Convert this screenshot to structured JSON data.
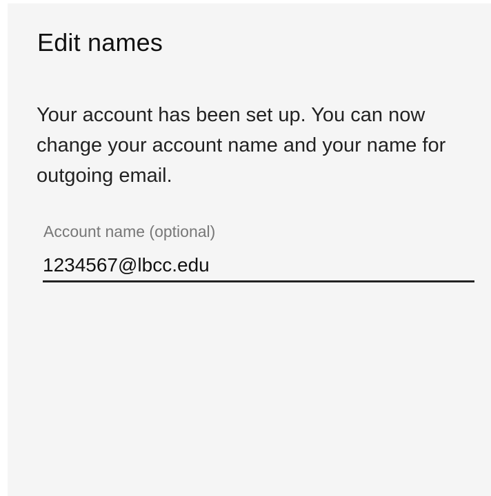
{
  "dialog": {
    "title": "Edit names",
    "message": "Your account has been set up. You can now change your account name and your name for outgoing email.",
    "account_name_field": {
      "label": "Account name (optional)",
      "value": "1234567@lbcc.edu"
    }
  }
}
